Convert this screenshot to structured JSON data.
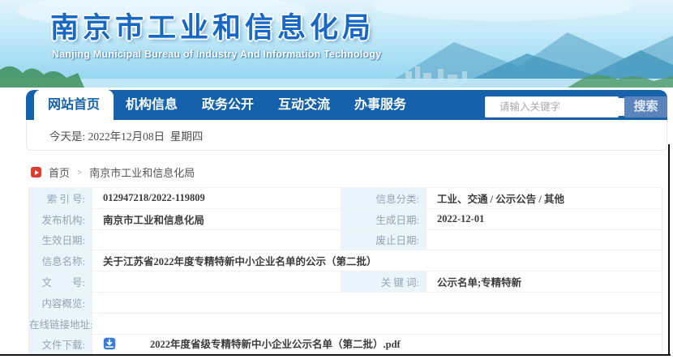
{
  "banner": {
    "title": "南京市工业和信息化局",
    "subtitle": "Nanjing Municipal Bureau of Industry And Information Technology"
  },
  "nav": {
    "tabs": [
      {
        "label": "网站首页",
        "active": true
      },
      {
        "label": "机构信息",
        "active": false
      },
      {
        "label": "政务公开",
        "active": false
      },
      {
        "label": "互动交流",
        "active": false
      },
      {
        "label": "办事服务",
        "active": false
      }
    ],
    "search": {
      "icon": "search-icon",
      "placeholder": "请输入关键字",
      "button_label": "搜索"
    }
  },
  "dateline": {
    "text": "今天是: 2022年12月08日  星期四"
  },
  "breadcrumb": {
    "icon": "breadcrumb-marker-icon",
    "separator": ">",
    "items": [
      "首页",
      "南京市工业和信息化局"
    ]
  },
  "info_table": {
    "rows": [
      [
        {
          "t": "label",
          "text": "索 引 号:"
        },
        {
          "t": "value",
          "text": "012947218/2022-119809"
        },
        {
          "t": "label",
          "text": "信息分类:"
        },
        {
          "t": "value",
          "text": "工业、交通 / 公示公告 / 其他"
        }
      ],
      [
        {
          "t": "label",
          "text": "发布机构:"
        },
        {
          "t": "value",
          "text": "南京市工业和信息化局"
        },
        {
          "t": "label",
          "text": "生成日期:"
        },
        {
          "t": "value",
          "text": "2022-12-01"
        }
      ],
      [
        {
          "t": "label",
          "text": "生效日期:"
        },
        {
          "t": "value",
          "text": ""
        },
        {
          "t": "label",
          "text": "废止日期:"
        },
        {
          "t": "value",
          "text": ""
        }
      ],
      [
        {
          "t": "label",
          "text": "信息名称:"
        },
        {
          "t": "value",
          "text": "关于江苏省2022年度专精特新中小企业名单的公示（第二批）",
          "span": 3
        }
      ],
      [
        {
          "t": "label",
          "text": "文　　号:"
        },
        {
          "t": "value",
          "text": ""
        },
        {
          "t": "label",
          "text": "关 键 词:"
        },
        {
          "t": "value",
          "text": "公示名单;专精特新"
        }
      ],
      [
        {
          "t": "label",
          "text": "内容概览:"
        },
        {
          "t": "value",
          "text": "",
          "span": 3
        }
      ],
      [
        {
          "t": "label",
          "text": "在线链接地址:"
        },
        {
          "t": "value",
          "text": "",
          "span": 3
        }
      ],
      [
        {
          "t": "label",
          "text": "文件下载:"
        },
        {
          "t": "value",
          "text": "2022年度省级专精特新中小企业公示名单（第二批）.pdf",
          "span": 3,
          "icon": "download-icon",
          "link": true
        }
      ]
    ]
  },
  "colors": {
    "nav_blue": "#1561ab",
    "banner_title_blue": "#1668c4",
    "label_cell_bg": "#e9f4fb",
    "label_text": "#93a4b5",
    "value_text": "#3c3c3c",
    "search_button_bg": "#5b84bd",
    "breadcrumb_red": "#e23c2e",
    "download_icon_blue": "#3a7cd4"
  }
}
